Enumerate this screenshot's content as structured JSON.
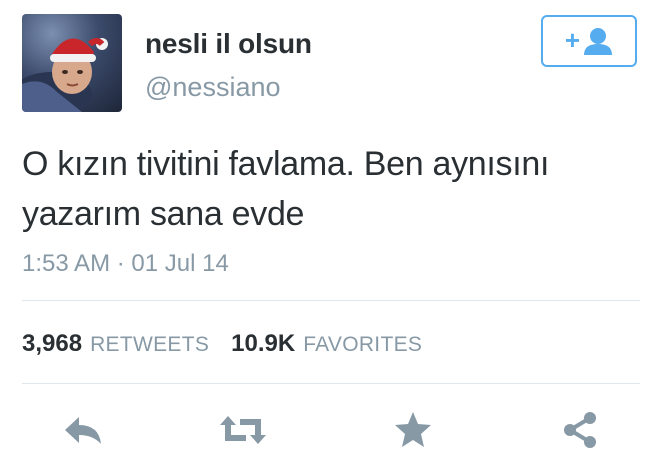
{
  "user": {
    "name": "nesli il olsun",
    "handle": "@nessiano"
  },
  "follow_button": {
    "icon": "add-user-icon",
    "plus_glyph": "+"
  },
  "tweet": {
    "text_lines": [
      "O kızın tivitini favlama. Ben aynısını",
      "yazarım sana evde"
    ],
    "timestamp": "1:53 AM · 01 Jul 14"
  },
  "stats": {
    "retweets_count": "3,968",
    "retweets_label": "RETWEETS",
    "favorites_count": "10.9K",
    "favorites_label": "FAVORITES"
  },
  "actions": [
    {
      "name": "reply",
      "icon": "reply-icon"
    },
    {
      "name": "retweet",
      "icon": "retweet-icon"
    },
    {
      "name": "favorite",
      "icon": "star-icon"
    },
    {
      "name": "share",
      "icon": "share-icon"
    }
  ],
  "colors": {
    "accent": "#55acee",
    "text": "#292f33",
    "muted": "#8899a6",
    "icon": "#8899a6",
    "divider": "#e1e8ed"
  }
}
